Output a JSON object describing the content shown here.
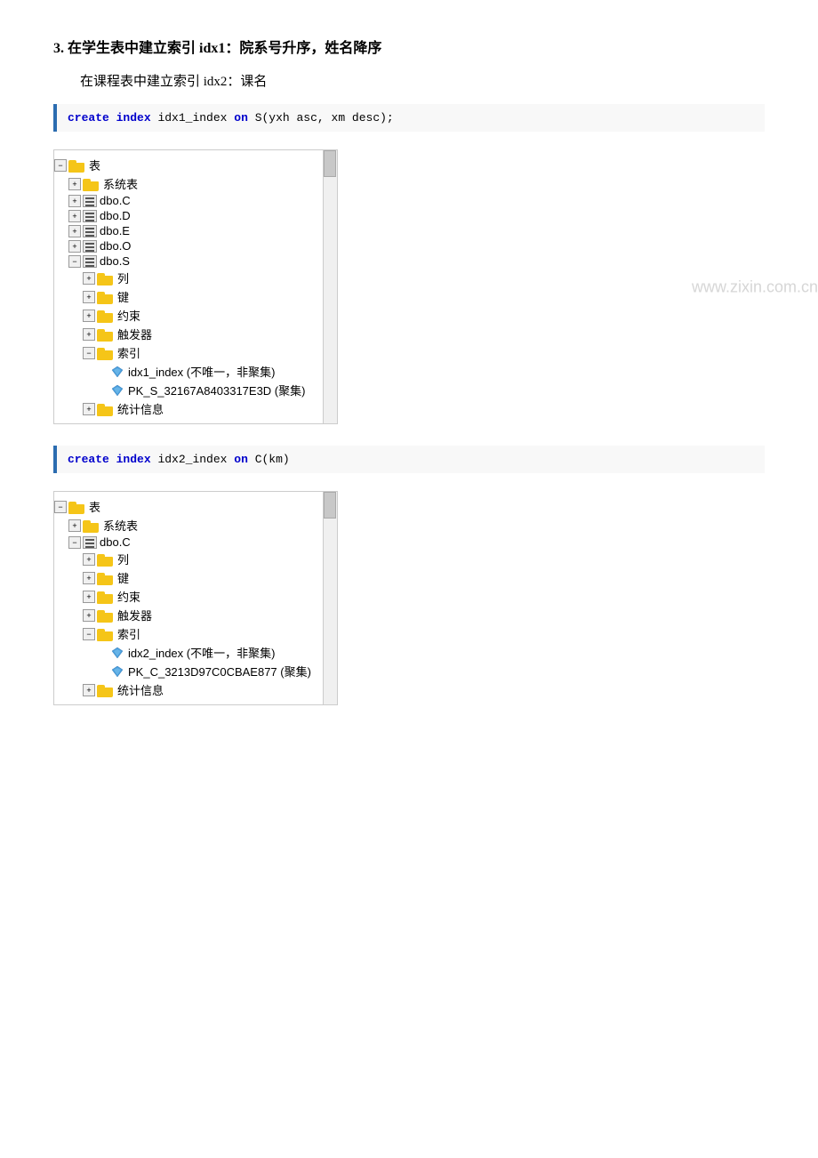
{
  "page": {
    "section3": {
      "title": "3.  在学生表中建立索引 idx1：院系号升序，姓名降序",
      "subtitle": "在课程表中建立索引 idx2：课名",
      "code1": "create index idx1_index on S(yxh asc, xm desc);",
      "code2": "create index idx2_index on C(km)",
      "code1_parts": {
        "keyword1": "create",
        "keyword2": "index",
        "name1": "idx1_index",
        "keyword3": "on",
        "rest": "S(yxh asc, xm desc);"
      },
      "code2_parts": {
        "keyword1": "create",
        "keyword2": "index",
        "name1": "idx2_index",
        "keyword3": "on",
        "rest": "C(km)"
      }
    },
    "tree1": {
      "nodes": [
        {
          "id": "t1-n1",
          "indent": 0,
          "expand": "minus",
          "icon": "folder",
          "label": "表"
        },
        {
          "id": "t1-n2",
          "indent": 1,
          "expand": "plus",
          "icon": "folder",
          "label": "系统表"
        },
        {
          "id": "t1-n3",
          "indent": 1,
          "expand": "plus",
          "icon": "table",
          "label": "dbo.C"
        },
        {
          "id": "t1-n4",
          "indent": 1,
          "expand": "plus",
          "icon": "table",
          "label": "dbo.D"
        },
        {
          "id": "t1-n5",
          "indent": 1,
          "expand": "plus",
          "icon": "table",
          "label": "dbo.E"
        },
        {
          "id": "t1-n6",
          "indent": 1,
          "expand": "plus",
          "icon": "table",
          "label": "dbo.O"
        },
        {
          "id": "t1-n7",
          "indent": 1,
          "expand": "minus",
          "icon": "table",
          "label": "dbo.S"
        },
        {
          "id": "t1-n8",
          "indent": 2,
          "expand": "plus",
          "icon": "folder",
          "label": "列"
        },
        {
          "id": "t1-n9",
          "indent": 2,
          "expand": "plus",
          "icon": "folder",
          "label": "键"
        },
        {
          "id": "t1-n10",
          "indent": 2,
          "expand": "plus",
          "icon": "folder",
          "label": "约束"
        },
        {
          "id": "t1-n11",
          "indent": 2,
          "expand": "plus",
          "icon": "folder",
          "label": "触发器"
        },
        {
          "id": "t1-n12",
          "indent": 2,
          "expand": "minus",
          "icon": "folder",
          "label": "索引"
        },
        {
          "id": "t1-n13",
          "indent": 3,
          "expand": "none",
          "icon": "index",
          "label": "idx1_index (不唯一，非聚集)"
        },
        {
          "id": "t1-n14",
          "indent": 3,
          "expand": "none",
          "icon": "index",
          "label": "PK_S_32167A8403317E3D (聚集)"
        },
        {
          "id": "t1-n15",
          "indent": 2,
          "expand": "plus",
          "icon": "folder",
          "label": "统计信息"
        }
      ]
    },
    "tree2": {
      "nodes": [
        {
          "id": "t2-n1",
          "indent": 0,
          "expand": "minus",
          "icon": "folder",
          "label": "表"
        },
        {
          "id": "t2-n2",
          "indent": 1,
          "expand": "plus",
          "icon": "folder",
          "label": "系统表"
        },
        {
          "id": "t2-n3",
          "indent": 1,
          "expand": "minus",
          "icon": "table",
          "label": "dbo.C"
        },
        {
          "id": "t2-n4",
          "indent": 2,
          "expand": "plus",
          "icon": "folder",
          "label": "列"
        },
        {
          "id": "t2-n5",
          "indent": 2,
          "expand": "plus",
          "icon": "folder",
          "label": "键"
        },
        {
          "id": "t2-n6",
          "indent": 2,
          "expand": "plus",
          "icon": "folder",
          "label": "约束"
        },
        {
          "id": "t2-n7",
          "indent": 2,
          "expand": "plus",
          "icon": "folder",
          "label": "触发器"
        },
        {
          "id": "t2-n8",
          "indent": 2,
          "expand": "minus",
          "icon": "folder",
          "label": "索引"
        },
        {
          "id": "t2-n9",
          "indent": 3,
          "expand": "none",
          "icon": "index",
          "label": "idx2_index (不唯一，非聚集)"
        },
        {
          "id": "t2-n10",
          "indent": 3,
          "expand": "none",
          "icon": "index",
          "label": "PK_C_3213D97C0CBAE877 (聚集)"
        },
        {
          "id": "t2-n11",
          "indent": 2,
          "expand": "plus",
          "icon": "folder",
          "label": "统计信息"
        }
      ]
    },
    "watermark": "www.zixin.com.cn"
  }
}
